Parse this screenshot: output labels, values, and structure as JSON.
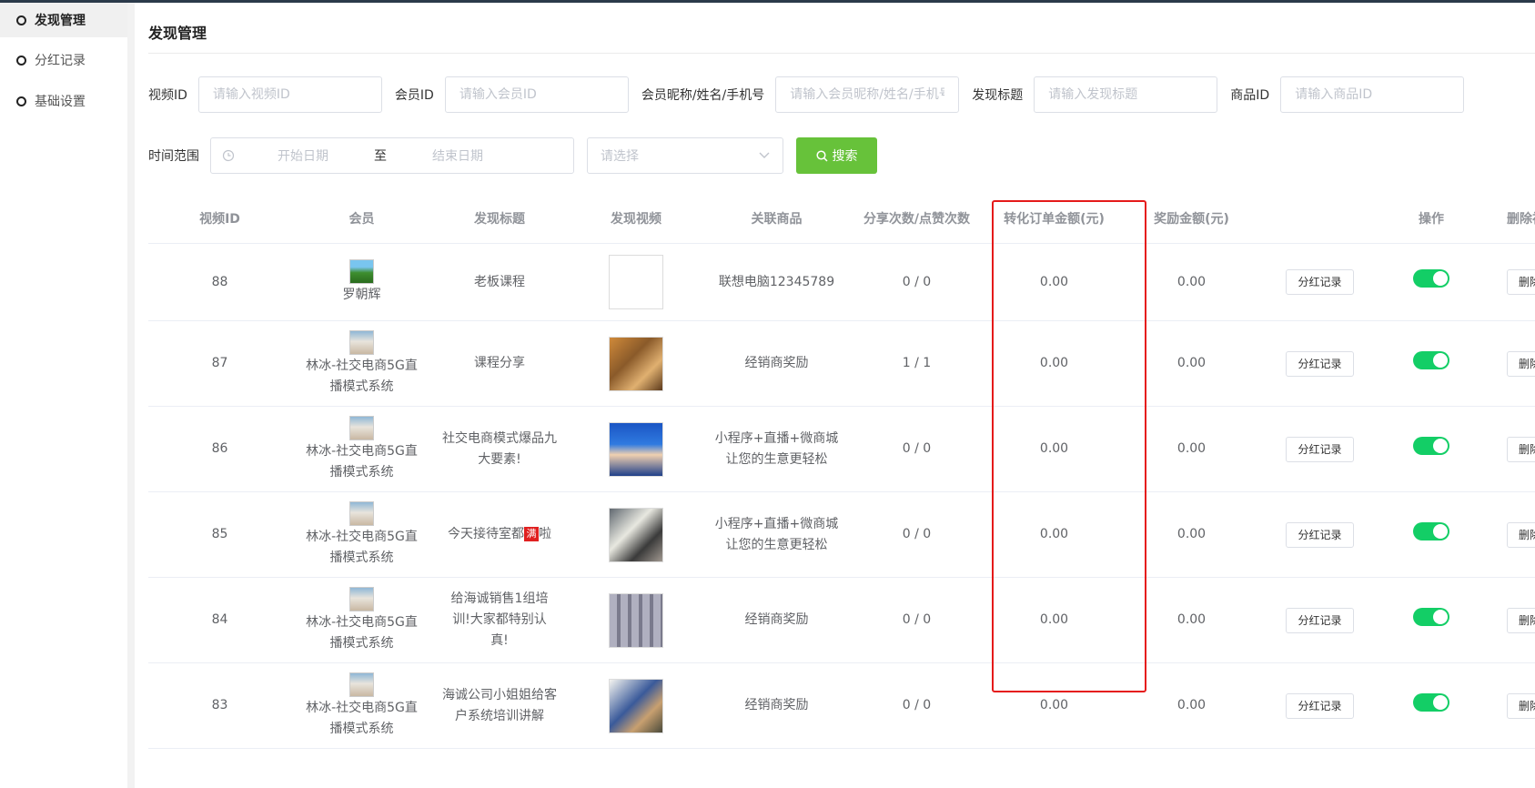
{
  "sidebar": {
    "items": [
      {
        "label": "发现管理",
        "active": true
      },
      {
        "label": "分红记录",
        "active": false
      },
      {
        "label": "基础设置",
        "active": false
      }
    ]
  },
  "page": {
    "title": "发现管理"
  },
  "filters": {
    "video_id": {
      "label": "视频ID",
      "placeholder": "请输入视频ID"
    },
    "member_id": {
      "label": "会员ID",
      "placeholder": "请输入会员ID"
    },
    "member_info": {
      "label": "会员昵称/姓名/手机号",
      "placeholder": "请输入会员昵称/姓名/手机号"
    },
    "discover_title": {
      "label": "发现标题",
      "placeholder": "请输入发现标题"
    },
    "product_id": {
      "label": "商品ID",
      "placeholder": "请输入商品ID"
    },
    "time_range": {
      "label": "时间范围",
      "start_placeholder": "开始日期",
      "separator": "至",
      "end_placeholder": "结束日期"
    },
    "select": {
      "placeholder": "请选择"
    },
    "search_button": "搜索"
  },
  "table": {
    "headers": [
      "视频ID",
      "会员",
      "发现标题",
      "发现视频",
      "关联商品",
      "分享次数/点赞次数",
      "转化订单金额(元)",
      "奖励金额(元)",
      "",
      "操作",
      "删除视"
    ],
    "record_button": "分红记录",
    "delete_button": "删除",
    "rows": [
      {
        "id": "88",
        "member_line1": "罗朝辉",
        "member_line2": "",
        "title_line1": "老板课程",
        "title_line2": "",
        "title_line3": "",
        "product_line1": "联想电脑12345789",
        "product_line2": "",
        "counts": "0 / 0",
        "order_amount": "0.00",
        "reward": "0.00",
        "enabled": true
      },
      {
        "id": "87",
        "member_line1": "林冰-社交电商5G直",
        "member_line2": "播模式系统",
        "title_line1": "课程分享",
        "title_line2": "",
        "title_line3": "",
        "product_line1": "经销商奖励",
        "product_line2": "",
        "counts": "1 / 1",
        "order_amount": "0.00",
        "reward": "0.00",
        "enabled": true
      },
      {
        "id": "86",
        "member_line1": "林冰-社交电商5G直",
        "member_line2": "播模式系统",
        "title_line1": "社交电商模式爆品九",
        "title_line2": "大要素!",
        "title_line3": "",
        "product_line1": "小程序+直播+微商城",
        "product_line2": "让您的生意更轻松",
        "counts": "0 / 0",
        "order_amount": "0.00",
        "reward": "0.00",
        "enabled": true
      },
      {
        "id": "85",
        "member_line1": "林冰-社交电商5G直",
        "member_line2": "播模式系统",
        "title_line1": "今天接待室都",
        "title_mark": "满",
        "title_after": "啦",
        "title_line2": "",
        "title_line3": "",
        "product_line1": "小程序+直播+微商城",
        "product_line2": "让您的生意更轻松",
        "counts": "0 / 0",
        "order_amount": "0.00",
        "reward": "0.00",
        "enabled": true
      },
      {
        "id": "84",
        "member_line1": "林冰-社交电商5G直",
        "member_line2": "播模式系统",
        "title_line1": "给海诚销售1组培",
        "title_line2": "训!大家都特别认",
        "title_line3": "真!",
        "product_line1": "经销商奖励",
        "product_line2": "",
        "counts": "0 / 0",
        "order_amount": "0.00",
        "reward": "0.00",
        "enabled": true
      },
      {
        "id": "83",
        "member_line1": "林冰-社交电商5G直",
        "member_line2": "播模式系统",
        "title_line1": "海诚公司小姐姐给客",
        "title_line2": "户系统培训讲解",
        "title_line3": "",
        "product_line1": "经销商奖励",
        "product_line2": "",
        "counts": "0 / 0",
        "order_amount": "0.00",
        "reward": "0.00",
        "enabled": true
      }
    ]
  },
  "colors": {
    "accent": "#67c23a",
    "toggle_on": "#13ce66",
    "highlight": "#e51a1a"
  }
}
